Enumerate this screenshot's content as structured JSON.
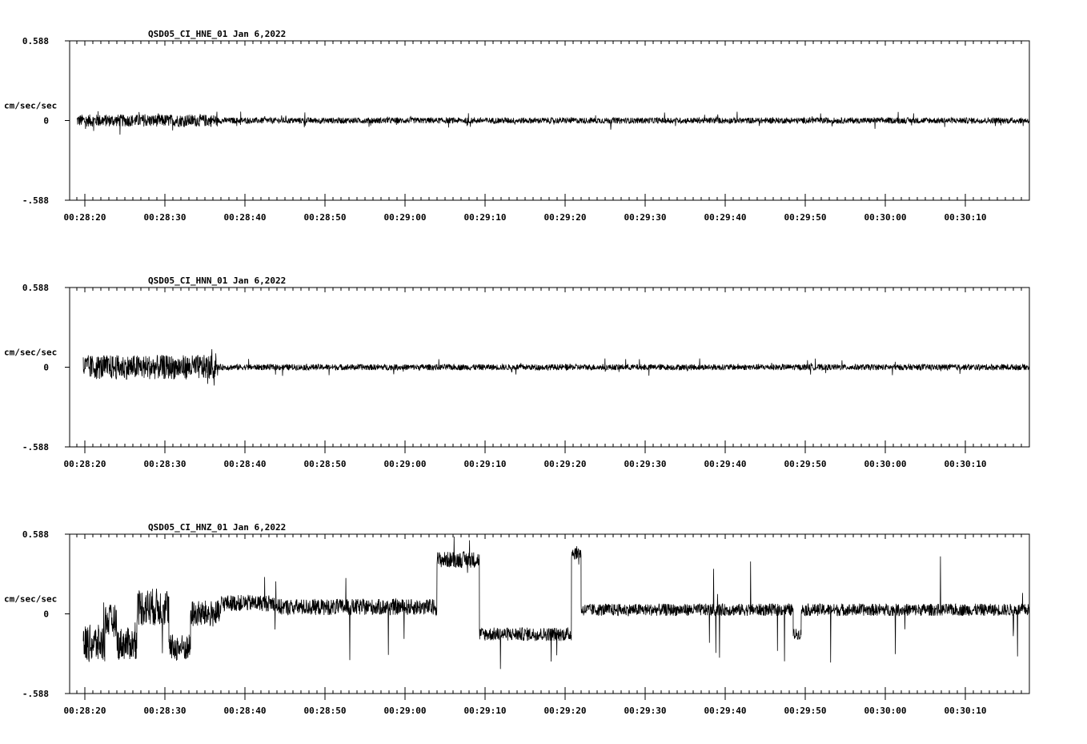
{
  "chart_data": [
    {
      "type": "line",
      "title": "QSD05_CI_HNE_01  Jan 6,2022",
      "ylabel": "cm/sec/sec",
      "ylim": [
        -0.588,
        0.588
      ],
      "y_ticks": [
        "0.588",
        "0",
        "-.588"
      ],
      "x_ticks": [
        "00:28:20",
        "00:28:30",
        "00:28:40",
        "00:28:50",
        "00:29:00",
        "00:29:10",
        "00:29:20",
        "00:29:30",
        "00:29:40",
        "00:29:50",
        "00:30:00",
        "00:30:10"
      ],
      "grid": false,
      "series": [
        {
          "color": "#000000",
          "segments": [
            {
              "t0": -1.0,
              "t1": 16.6,
              "base": 0.0,
              "amp": 0.045,
              "spikes": 0.02
            },
            {
              "t0": 16.6,
              "t1": 118.0,
              "base": 0.0,
              "amp": 0.022,
              "spikes": 0.015
            }
          ]
        }
      ]
    },
    {
      "type": "line",
      "title": "QSD05_CI_HNN_01  Jan 6,2022",
      "ylabel": "cm/sec/sec",
      "ylim": [
        -0.588,
        0.588
      ],
      "y_ticks": [
        "0.588",
        "0",
        "-.588"
      ],
      "x_ticks": [
        "00:28:20",
        "00:28:30",
        "00:28:40",
        "00:28:50",
        "00:29:00",
        "00:29:10",
        "00:29:20",
        "00:29:30",
        "00:29:40",
        "00:29:50",
        "00:30:00",
        "00:30:10"
      ],
      "grid": false,
      "series": [
        {
          "color": "#000000",
          "segments": [
            {
              "t0": -0.2,
              "t1": 16.4,
              "base": 0.0,
              "amp": 0.09,
              "spikes": 0.02
            },
            {
              "t0": 16.4,
              "t1": 118.0,
              "base": 0.0,
              "amp": 0.022,
              "spikes": 0.015
            }
          ]
        }
      ]
    },
    {
      "type": "line",
      "title": "QSD05_CI_HNZ_01  Jan 6,2022",
      "ylabel": "cm/sec/sec",
      "ylim": [
        -0.588,
        0.588
      ],
      "y_ticks": [
        "0.588",
        "0",
        "-.588"
      ],
      "x_ticks": [
        "00:28:20",
        "00:28:30",
        "00:28:40",
        "00:28:50",
        "00:29:00",
        "00:29:10",
        "00:29:20",
        "00:29:30",
        "00:29:40",
        "00:29:50",
        "00:30:00",
        "00:30:10"
      ],
      "grid": false,
      "series": [
        {
          "color": "#000000",
          "segments": [
            {
              "t0": -0.2,
              "t1": 2.5,
              "base": -0.22,
              "amp": 0.14,
              "spikes": 0.08
            },
            {
              "t0": 2.5,
              "t1": 4.0,
              "base": -0.05,
              "amp": 0.12,
              "spikes": 0.06
            },
            {
              "t0": 4.0,
              "t1": 6.5,
              "base": -0.22,
              "amp": 0.12,
              "spikes": 0.06
            },
            {
              "t0": 6.5,
              "t1": 10.5,
              "base": 0.05,
              "amp": 0.14,
              "spikes": 0.08
            },
            {
              "t0": 10.5,
              "t1": 13.2,
              "base": -0.25,
              "amp": 0.1,
              "spikes": 0.05
            },
            {
              "t0": 13.2,
              "t1": 17.0,
              "base": 0.0,
              "amp": 0.1,
              "spikes": 0.06
            },
            {
              "t0": 17.0,
              "t1": 24.0,
              "base": 0.08,
              "amp": 0.06,
              "spikes": 0.05
            },
            {
              "t0": 24.0,
              "t1": 34.0,
              "base": 0.05,
              "amp": 0.06,
              "spikes": 0.2
            },
            {
              "t0": 34.0,
              "t1": 44.0,
              "base": 0.05,
              "amp": 0.06,
              "spikes": 0.15
            },
            {
              "t0": 44.0,
              "t1": 49.3,
              "base": 0.4,
              "amp": 0.06,
              "spikes": 0.04
            },
            {
              "t0": 49.3,
              "t1": 60.8,
              "base": -0.15,
              "amp": 0.05,
              "spikes": 0.12
            },
            {
              "t0": 60.8,
              "t1": 62.0,
              "base": 0.45,
              "amp": 0.05,
              "spikes": 0.03
            },
            {
              "t0": 62.0,
              "t1": 88.5,
              "base": 0.03,
              "amp": 0.045,
              "spikes": 0.12
            },
            {
              "t0": 88.5,
              "t1": 89.5,
              "base": -0.15,
              "amp": 0.04,
              "spikes": 0.05
            },
            {
              "t0": 89.5,
              "t1": 118.0,
              "base": 0.03,
              "amp": 0.045,
              "spikes": 0.14
            }
          ]
        }
      ]
    }
  ]
}
